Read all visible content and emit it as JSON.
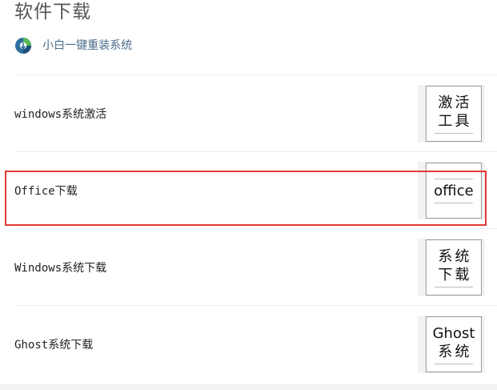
{
  "header": {
    "title": "软件下载"
  },
  "source": {
    "label": "小白一键重装系统",
    "icon": "app-logo-icon"
  },
  "items": [
    {
      "label": "windows系统激活",
      "thumb_lines": [
        "激活",
        "工具"
      ]
    },
    {
      "label": "Office下载",
      "thumb_lines": [
        "office"
      ]
    },
    {
      "label": "Windows系统下载",
      "thumb_lines": [
        "系统",
        "下载"
      ]
    },
    {
      "label": "Ghost系统下载",
      "thumb_lines": [
        "Ghost",
        "系统"
      ]
    }
  ],
  "highlight": {
    "item": "Office下载",
    "color": "#e53935"
  }
}
